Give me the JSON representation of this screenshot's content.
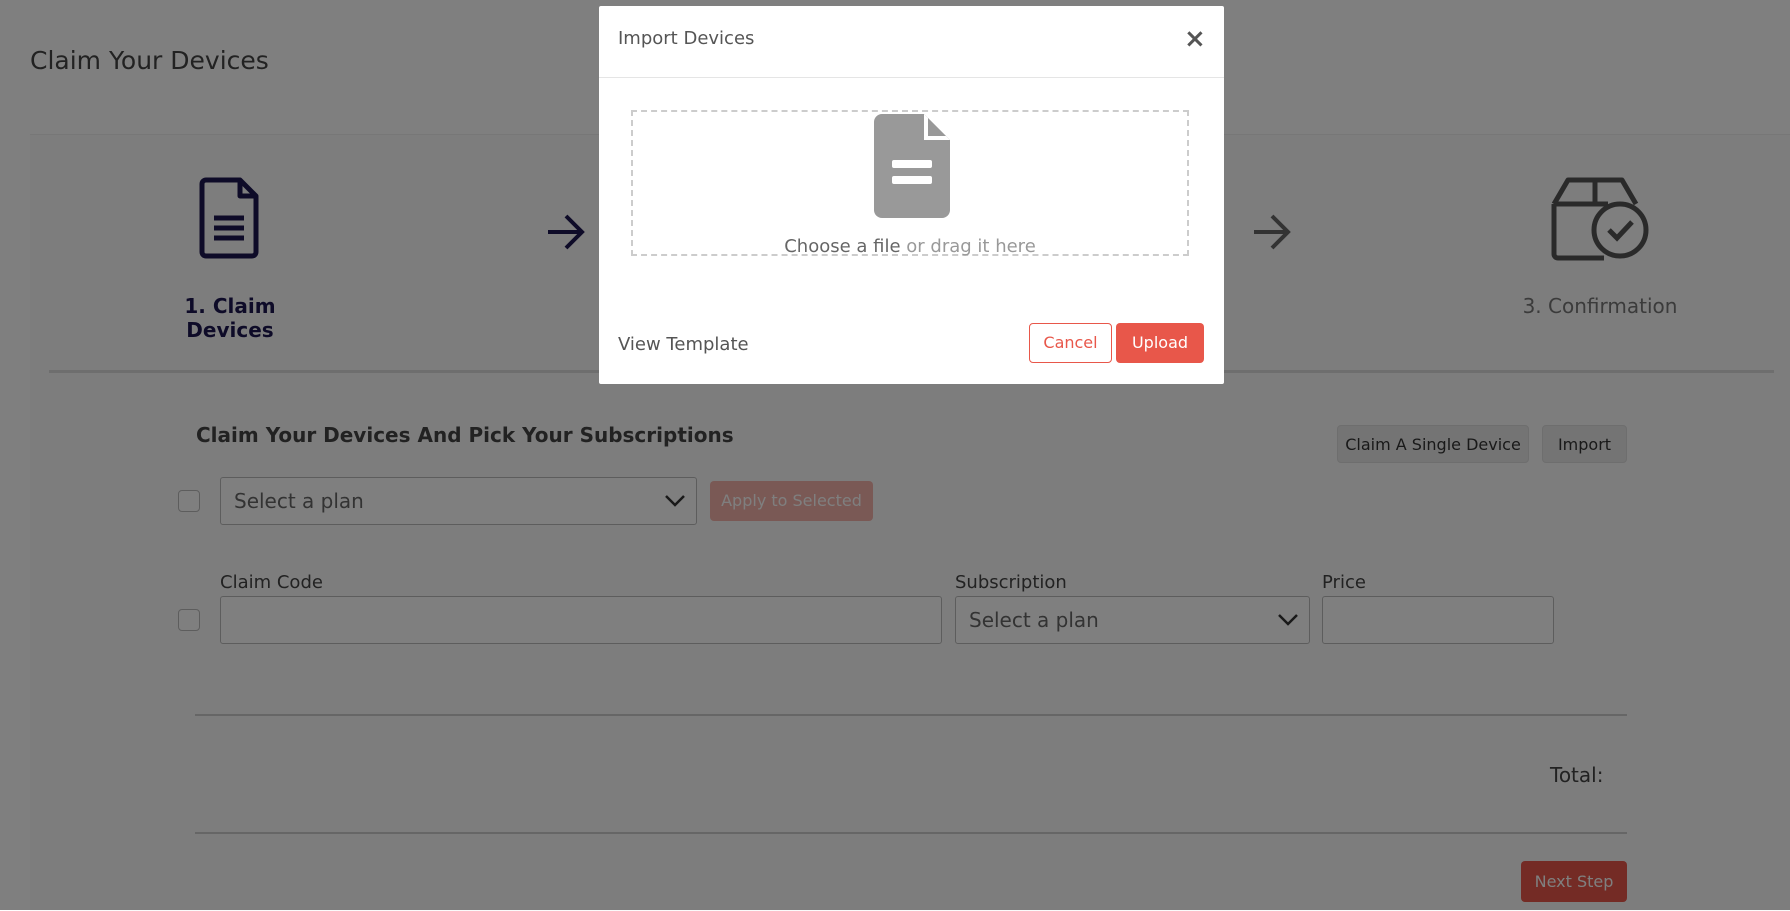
{
  "page": {
    "title": "Claim Your Devices"
  },
  "steps": [
    {
      "label": "1. Claim Devices",
      "icon": "document-icon",
      "state": "active"
    },
    {
      "label": "3. Confirmation",
      "icon": "box-check-icon",
      "state": "inactive"
    }
  ],
  "section": {
    "title": "Claim Your Devices And Pick Your Subscriptions",
    "claim_single_label": "Claim A Single Device",
    "import_label": "Import",
    "bulk_plan_placeholder": "Select a plan",
    "apply_label": "Apply to Selected"
  },
  "row": {
    "claim_code_label": "Claim Code",
    "subscription_label": "Subscription",
    "subscription_placeholder": "Select a plan",
    "price_label": "Price"
  },
  "footer": {
    "total_label": "Total:",
    "next_label": "Next Step"
  },
  "modal": {
    "title": "Import Devices",
    "close_glyph": "×",
    "choose_file": "Choose a file",
    "drag_text": " or drag it here",
    "view_template": "View Template",
    "cancel_label": "Cancel",
    "upload_label": "Upload"
  },
  "colors": {
    "accent": "#e8574a",
    "step_active": "#1c1650"
  }
}
